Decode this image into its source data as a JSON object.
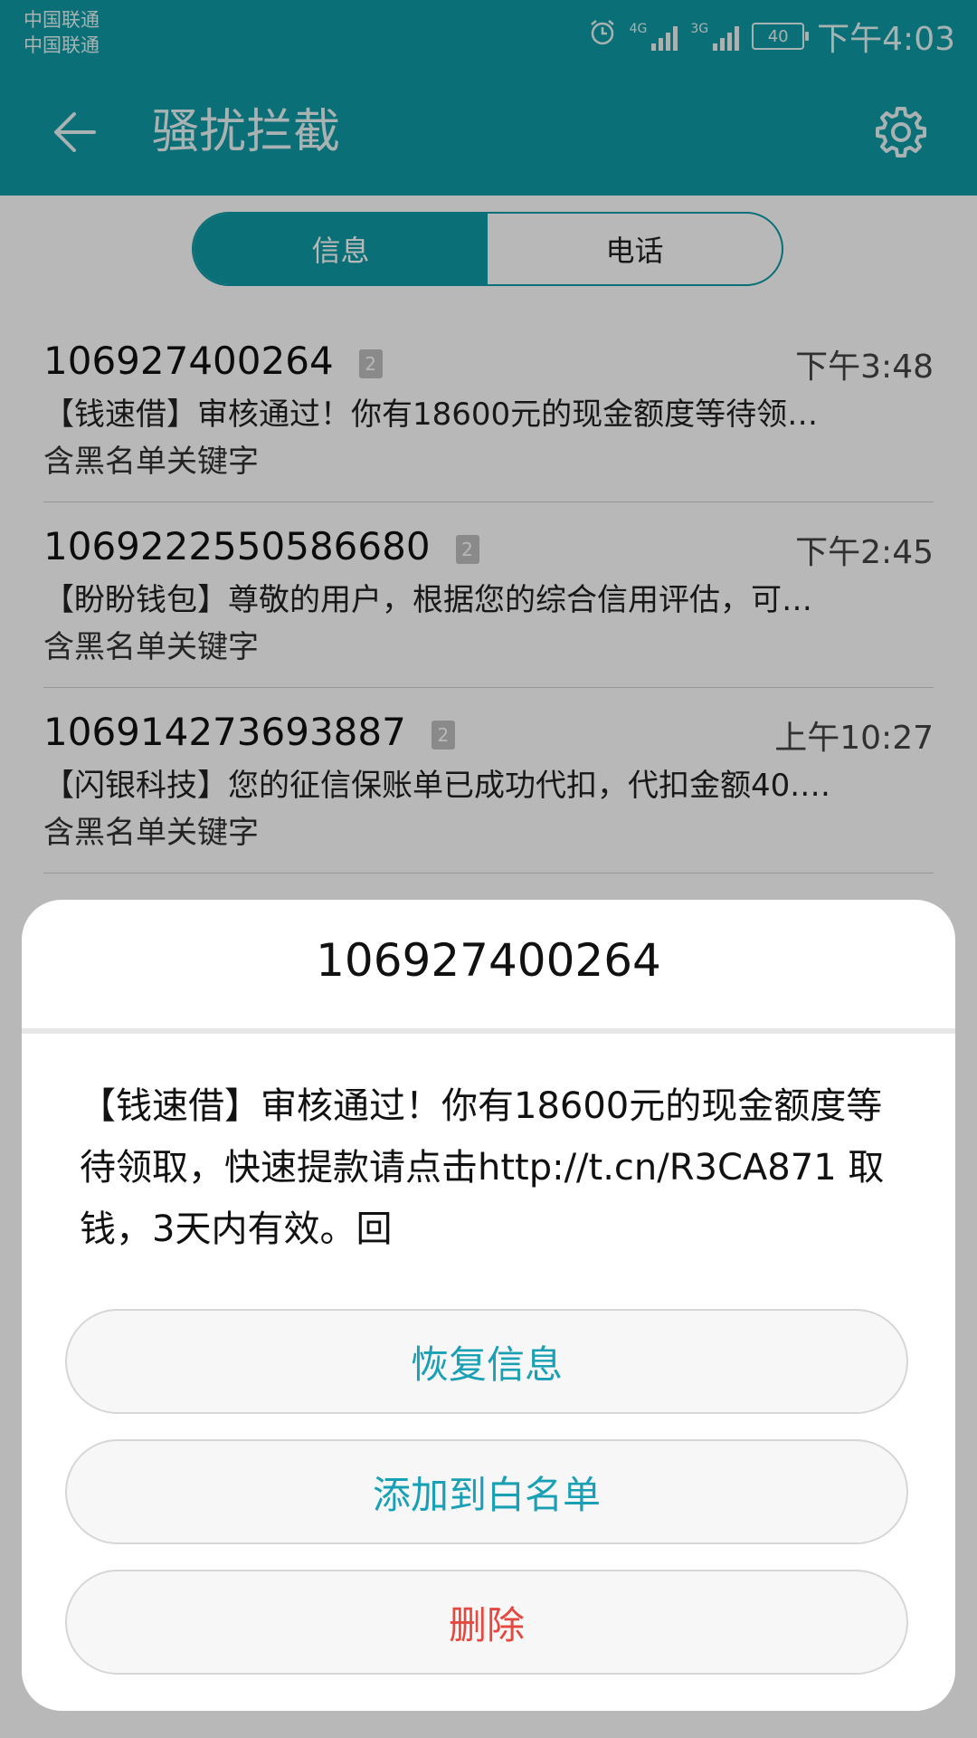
{
  "status_bar": {
    "carrier1": "中国联通",
    "carrier2": "中国联通",
    "net1": "4G",
    "net2": "3G",
    "battery": "40",
    "time": "下午4:03",
    "icons": [
      "alarm-icon",
      "signal-icon",
      "signal-icon",
      "battery-icon"
    ]
  },
  "header": {
    "title": "骚扰拦截",
    "back_icon": "back-arrow-icon",
    "settings_icon": "gear-icon"
  },
  "tabs": [
    {
      "label": "信息",
      "active": true
    },
    {
      "label": "电话",
      "active": false
    }
  ],
  "messages": [
    {
      "number": "106927400264",
      "sim": "2",
      "time": "下午3:48",
      "preview": "【钱速借】审核通过！你有18600元的现金额度等待领…",
      "reason": "含黑名单关键字"
    },
    {
      "number": "1069222550586680",
      "sim": "2",
      "time": "下午2:45",
      "preview": "【盼盼钱包】尊敬的用户，根据您的综合信用评估，可…",
      "reason": "含黑名单关键字"
    },
    {
      "number": "106914273693887",
      "sim": "2",
      "time": "上午10:27",
      "preview": "【闪银科技】您的征信保账单已成功代扣，代扣金额40.…",
      "reason": "含黑名单关键字"
    }
  ],
  "dialog": {
    "title": "106927400264",
    "body": "【钱速借】审核通过！你有18600元的现金额度等待领取，快速提款请点击http://t.cn/R3CA871 取钱，3天内有效。回",
    "buttons": {
      "restore": "恢复信息",
      "whitelist": "添加到白名单",
      "delete": "删除"
    }
  },
  "colors": {
    "accent": "#0e9aa4",
    "button_text": "#1aa0b5",
    "delete_text": "#e5483f"
  }
}
